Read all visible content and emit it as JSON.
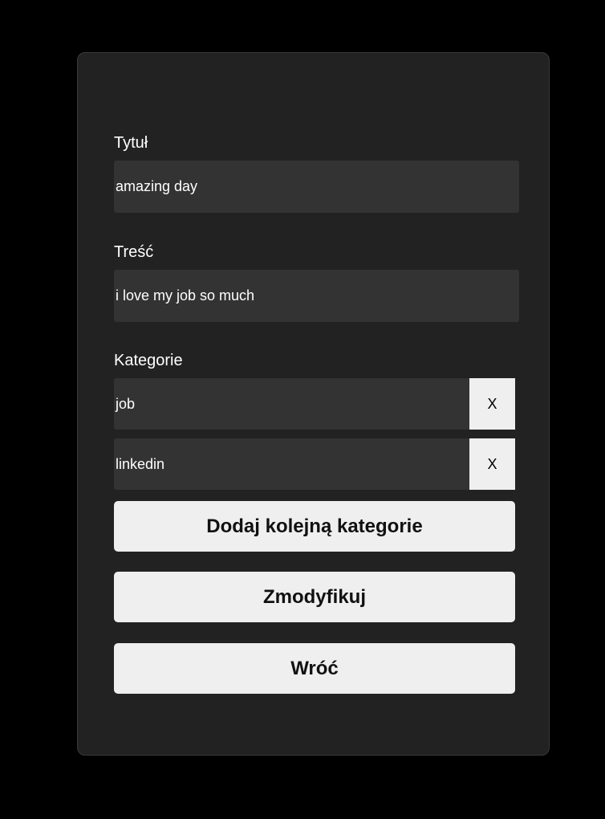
{
  "form": {
    "title_label": "Tytuł",
    "title_value": "amazing day",
    "content_label": "Treść",
    "content_value": "i love my job so much",
    "categories_label": "Kategorie",
    "categories": [
      {
        "value": "job",
        "remove_label": "X"
      },
      {
        "value": "linkedin",
        "remove_label": "X"
      }
    ],
    "add_category_label": "Dodaj kolejną kategorie",
    "modify_label": "Zmodyfikuj",
    "back_label": "Wróć"
  }
}
